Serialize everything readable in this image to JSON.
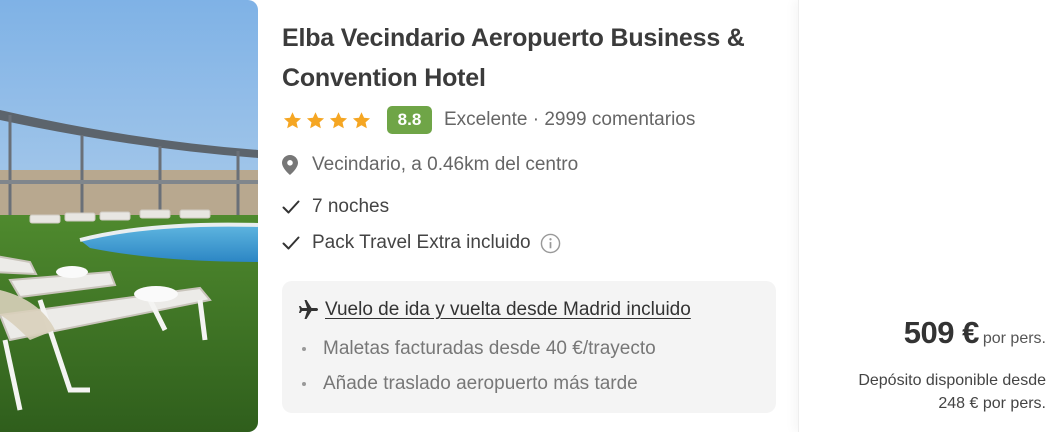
{
  "hotel": {
    "name": "Elba Vecindario Aeropuerto Business & Convention Hotel",
    "stars": 4,
    "score": "8.8",
    "reviews": "Excelente · 2999 comentarios",
    "location": "Vecindario, a 0.46km del centro",
    "nights": "7 noches",
    "pack": "Pack Travel Extra incluido"
  },
  "flight": {
    "title": "Vuelo de ida y vuelta desde Madrid incluido",
    "bullets": [
      "Maletas facturadas desde 40 €/trayecto",
      "Añade traslado aeropuerto más tarde"
    ]
  },
  "price": {
    "amount": "509 €",
    "per": "por pers.",
    "deposit_line1": "Depósito disponible desde",
    "deposit_line2": "248 € por pers."
  },
  "icons": {
    "star": "star-icon",
    "location": "location-pin-icon",
    "check": "check-icon",
    "info": "info-icon",
    "plane": "plane-icon"
  },
  "colors": {
    "score_badge": "#6fa547",
    "star": "#f5a623",
    "flight_box_bg": "#f4f4f4"
  }
}
